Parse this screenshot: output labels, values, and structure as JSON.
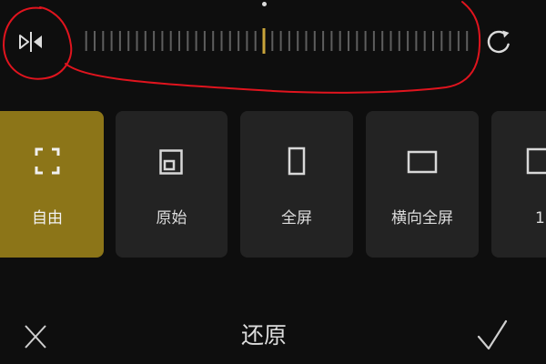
{
  "screen": {
    "background": "#0e0e0e"
  },
  "top_bar": {
    "flip_button": {
      "icon": "flip-horizontal-icon"
    },
    "rotation_dial": {
      "value_deg": 0,
      "accent": "#c9a43a",
      "tick_color": "#5e5e5e"
    },
    "rotate_button": {
      "icon": "rotate-icon"
    }
  },
  "aspect_ratios": {
    "selected_color": "#8c7518",
    "card_color": "#232323",
    "items": [
      {
        "label": "自由",
        "icon": "free-crop-icon",
        "selected": true
      },
      {
        "label": "原始",
        "icon": "original-ratio-icon",
        "selected": false
      },
      {
        "label": "全屏",
        "icon": "portrait-fullscreen-icon",
        "selected": false
      },
      {
        "label": "横向全屏",
        "icon": "landscape-fullscreen-icon",
        "selected": false
      },
      {
        "label": "1",
        "icon": "square-ratio-icon",
        "selected": false
      }
    ]
  },
  "bottom_bar": {
    "cancel_icon": "close-icon",
    "reset_label": "还原",
    "confirm_icon": "check-icon"
  },
  "annotation": {
    "color": "#e0141e"
  }
}
